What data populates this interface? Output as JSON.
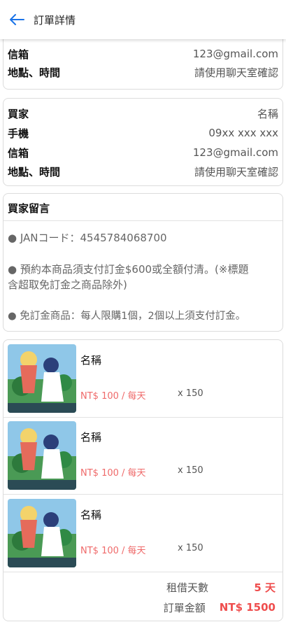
{
  "header": {
    "title": "訂單詳情",
    "back_icon": "arrow-left-icon",
    "accent_color": "#1a73e8"
  },
  "seller": {
    "email_label": "信箱",
    "email_value": "123@gmail.com",
    "place_label": "地點、時間",
    "place_value": "請使用聊天室確認"
  },
  "buyer": {
    "name_label": "買家",
    "name_value": "名稱",
    "phone_label": "手機",
    "phone_value": "09xx xxx xxx",
    "email_label": "信箱",
    "email_value": "123@gmail.com",
    "place_label": "地點、時間",
    "place_value": "請使用聊天室確認"
  },
  "message": {
    "title": "買家留言",
    "line1": "● JANコード：4545784068700",
    "line2a": "● 預約本商品須支付訂金$600或全額付清。(※標題",
    "line2b": "含超取免訂金之商品除外)",
    "line3": "● 免訂金商品：每人限購1個，2個以上須支付訂金。"
  },
  "items": [
    {
      "name": "名稱",
      "price": "NT$ 100 / 每天",
      "qty": "x 150"
    },
    {
      "name": "名稱",
      "price": "NT$ 100 / 每天",
      "qty": "x 150"
    },
    {
      "name": "名稱",
      "price": "NT$ 100 / 每天",
      "qty": "x 150"
    }
  ],
  "summary": {
    "days_label": "租借天數",
    "days_value": "5 天",
    "total_label": "訂單金額",
    "total_value": "NT$ 1500",
    "accent_color": "#ef4d4d"
  }
}
